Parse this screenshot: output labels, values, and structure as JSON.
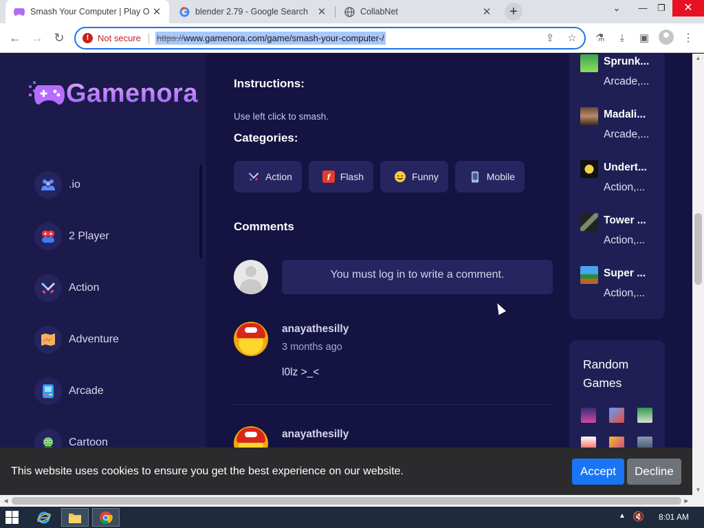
{
  "tabs": [
    {
      "title": "Smash Your Computer | Play On",
      "active": true
    },
    {
      "title": "blender 2.79 - Google Search",
      "active": false
    },
    {
      "title": "CollabNet",
      "active": false
    }
  ],
  "window": {
    "minimize": "—",
    "restore": "❐",
    "close": "✕",
    "tab_menu": "⌄",
    "new_tab": "+"
  },
  "address_bar": {
    "security_label": "Not secure",
    "url_scheme": "https://",
    "url_rest": "www.gamenora.com/game/smash-your-computer-/"
  },
  "site": {
    "logo_text": "Gamenora",
    "nav": [
      {
        "label": ".io",
        "icon": "people-icon"
      },
      {
        "label": "2 Player",
        "icon": "gamepad-icon"
      },
      {
        "label": "Action",
        "icon": "swords-icon"
      },
      {
        "label": "Adventure",
        "icon": "map-icon"
      },
      {
        "label": "Arcade",
        "icon": "arcade-icon"
      },
      {
        "label": "Cartoon",
        "icon": "cartoon-icon"
      }
    ]
  },
  "main": {
    "instructions_heading": "Instructions:",
    "instructions_text": "Use left click to smash.",
    "categories_heading": "Categories:",
    "categories": [
      {
        "label": "Action",
        "icon": "swords-icon"
      },
      {
        "label": "Flash",
        "icon": "flash-icon"
      },
      {
        "label": "Funny",
        "icon": "smiley-icon"
      },
      {
        "label": "Mobile",
        "icon": "mobile-icon"
      }
    ],
    "comments_heading": "Comments",
    "login_prompt": "You must log in to write a comment.",
    "comments": [
      {
        "user": "anayathesilly",
        "time": "3 months ago",
        "text": "l0lz >_<"
      },
      {
        "user": "anayathesilly"
      }
    ]
  },
  "sidebar_games": [
    {
      "title": "Sprunk...",
      "cats": "Arcade,..."
    },
    {
      "title": "Madali...",
      "cats": "Arcade,..."
    },
    {
      "title": "Undert...",
      "cats": "Action,..."
    },
    {
      "title": "Tower ...",
      "cats": "Action,..."
    },
    {
      "title": "Super ...",
      "cats": "Action,..."
    }
  ],
  "random_games": {
    "heading": "Random Games"
  },
  "cookie_bar": {
    "text": "This website uses cookies to ensure you get the best experience on our website.",
    "accept": "Accept",
    "decline": "Decline"
  },
  "taskbar": {
    "clock": "8:01 AM"
  },
  "colors": {
    "accent_blue": "#1a75f5",
    "page_bg": "#141342",
    "panel_bg": "#201f55",
    "warning_red": "#c5221f"
  }
}
